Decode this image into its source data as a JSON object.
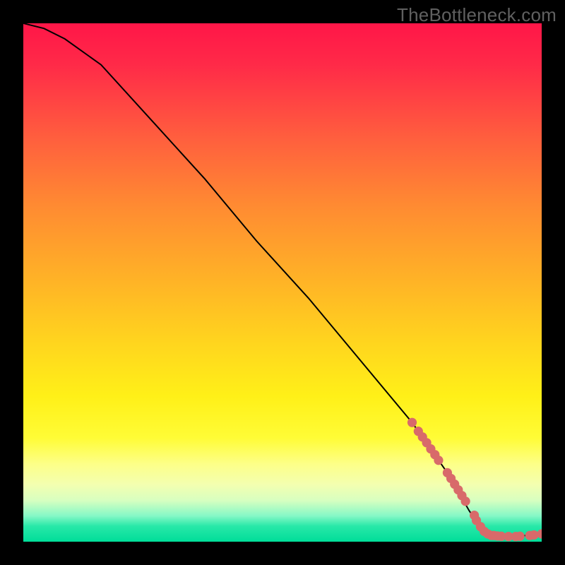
{
  "watermark": "TheBottleneck.com",
  "chart_data": {
    "type": "line",
    "title": "",
    "xlabel": "",
    "ylabel": "",
    "xlim": [
      0,
      100
    ],
    "ylim": [
      0,
      100
    ],
    "grid": false,
    "legend": false,
    "curve": {
      "x": [
        0,
        4,
        8,
        15,
        25,
        35,
        45,
        55,
        65,
        75,
        82,
        86,
        88,
        90,
        95,
        100
      ],
      "y": [
        100,
        99,
        97,
        92,
        81,
        70,
        58,
        47,
        35,
        23,
        13,
        6,
        3,
        1.2,
        1.0,
        1.5
      ]
    },
    "scatter_points": [
      {
        "x": 75.0,
        "y": 23.0
      },
      {
        "x": 76.2,
        "y": 21.3
      },
      {
        "x": 77.0,
        "y": 20.2
      },
      {
        "x": 77.8,
        "y": 19.1
      },
      {
        "x": 78.6,
        "y": 17.9
      },
      {
        "x": 79.4,
        "y": 16.8
      },
      {
        "x": 80.1,
        "y": 15.7
      },
      {
        "x": 81.8,
        "y": 13.3
      },
      {
        "x": 82.5,
        "y": 12.2
      },
      {
        "x": 83.2,
        "y": 11.1
      },
      {
        "x": 83.9,
        "y": 10.0
      },
      {
        "x": 84.6,
        "y": 8.9
      },
      {
        "x": 85.3,
        "y": 7.8
      },
      {
        "x": 87.0,
        "y": 5.1
      },
      {
        "x": 87.4,
        "y": 4.1
      },
      {
        "x": 88.2,
        "y": 2.9
      },
      {
        "x": 88.9,
        "y": 2.0
      },
      {
        "x": 89.6,
        "y": 1.5
      },
      {
        "x": 90.3,
        "y": 1.2
      },
      {
        "x": 90.8,
        "y": 1.2
      },
      {
        "x": 91.5,
        "y": 1.1
      },
      {
        "x": 92.2,
        "y": 1.05
      },
      {
        "x": 93.6,
        "y": 1.0
      },
      {
        "x": 95.0,
        "y": 1.0
      },
      {
        "x": 95.8,
        "y": 1.05
      },
      {
        "x": 97.7,
        "y": 1.2
      },
      {
        "x": 98.5,
        "y": 1.3
      },
      {
        "x": 100.0,
        "y": 1.5
      }
    ],
    "scatter_color": "#d86a6a",
    "curve_color": "#000000"
  }
}
